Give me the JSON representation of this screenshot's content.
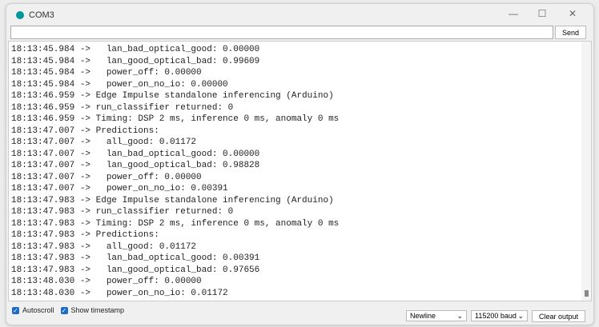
{
  "window": {
    "title": "COM3",
    "minimize": "—",
    "maximize": "☐",
    "close": "✕"
  },
  "input": {
    "value": "",
    "send_label": "Send"
  },
  "output": {
    "lines": [
      "18:13:45.984 ->   lan_bad_optical_good: 0.00000",
      "18:13:45.984 ->   lan_good_optical_bad: 0.99609",
      "18:13:45.984 ->   power_off: 0.00000",
      "18:13:45.984 ->   power_on_no_io: 0.00000",
      "18:13:46.959 -> Edge Impulse standalone inferencing (Arduino)",
      "18:13:46.959 -> run_classifier returned: 0",
      "18:13:46.959 -> Timing: DSP 2 ms, inference 0 ms, anomaly 0 ms",
      "18:13:47.007 -> Predictions:",
      "18:13:47.007 ->   all_good: 0.01172",
      "18:13:47.007 ->   lan_bad_optical_good: 0.00000",
      "18:13:47.007 ->   lan_good_optical_bad: 0.98828",
      "18:13:47.007 ->   power_off: 0.00000",
      "18:13:47.007 ->   power_on_no_io: 0.00391",
      "18:13:47.983 -> Edge Impulse standalone inferencing (Arduino)",
      "18:13:47.983 -> run_classifier returned: 0",
      "18:13:47.983 -> Timing: DSP 2 ms, inference 0 ms, anomaly 0 ms",
      "18:13:47.983 -> Predictions:",
      "18:13:47.983 ->   all_good: 0.01172",
      "18:13:47.983 ->   lan_bad_optical_good: 0.00391",
      "18:13:47.983 ->   lan_good_optical_bad: 0.97656",
      "18:13:48.030 ->   power_off: 0.00000",
      "18:13:48.030 ->   power_on_no_io: 0.01172"
    ]
  },
  "footer": {
    "autoscroll": "Autoscroll",
    "show_timestamp": "Show timestamp",
    "line_ending": "Newline",
    "baud": "115200 baud",
    "clear": "Clear output",
    "check": "✓",
    "chevron": "⌄"
  }
}
